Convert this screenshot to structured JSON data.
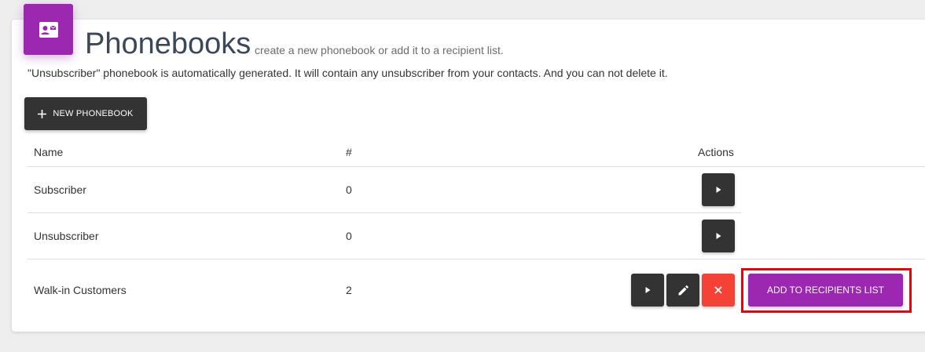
{
  "header": {
    "title": "Phonebooks",
    "subtitle": "create a new phonebook or add it to a recipient list.",
    "icon": "contact-card-icon",
    "accent_color": "#9c27b0"
  },
  "info_text": "\"Unsubscriber\" phonebook is automatically generated. It will contain any unsubscriber from your contacts. And you can not delete it.",
  "toolbar": {
    "new_label": "NEW PHONEBOOK",
    "new_icon": "plus-icon"
  },
  "table": {
    "columns": [
      "Name",
      "#",
      "Actions"
    ],
    "rows": [
      {
        "name": "Subscriber",
        "count": "0"
      },
      {
        "name": "Unsubscriber",
        "count": "0"
      },
      {
        "name": "Walk-in Customers",
        "count": "2"
      }
    ]
  },
  "actions": {
    "view_icon": "play-icon",
    "edit_icon": "pencil-icon",
    "delete_icon": "close-icon",
    "add_label": "ADD TO RECIPIENTS LIST",
    "delete_color": "#f44336",
    "dark_color": "#333333",
    "highlight_color": "#e0060c"
  }
}
